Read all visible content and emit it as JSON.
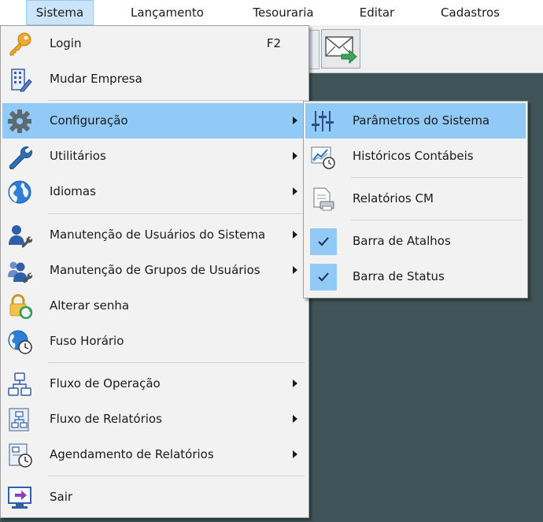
{
  "menubar": {
    "items": [
      {
        "label": "Sistema"
      },
      {
        "label": "Lançamento"
      },
      {
        "label": "Tesouraria"
      },
      {
        "label": "Editar"
      },
      {
        "label": "Cadastros"
      }
    ]
  },
  "menu_sistema": {
    "items": [
      {
        "label": "Login",
        "shortcut": "F2",
        "icon": "key-icon"
      },
      {
        "label": "Mudar Empresa",
        "icon": "building-edit-icon"
      },
      {
        "label": "Configuração",
        "icon": "gear-icon"
      },
      {
        "label": "Utilitários",
        "icon": "wrench-icon"
      },
      {
        "label": "Idiomas",
        "icon": "globe-icon"
      },
      {
        "label": "Manutenção de Usuários do Sistema",
        "icon": "user-wrench-icon"
      },
      {
        "label": "Manutenção de Grupos de Usuários",
        "icon": "group-wrench-icon"
      },
      {
        "label": "Alterar senha",
        "icon": "lock-refresh-icon"
      },
      {
        "label": "Fuso Horário",
        "icon": "globe-clock-icon"
      },
      {
        "label": "Fluxo de Operação",
        "icon": "flowchart-icon"
      },
      {
        "label": "Fluxo de Relatórios",
        "icon": "report-flow-icon"
      },
      {
        "label": "Agendamento de Relatórios",
        "icon": "report-schedule-icon"
      },
      {
        "label": "Sair",
        "icon": "exit-monitor-icon"
      }
    ]
  },
  "submenu_configuracao": {
    "items": [
      {
        "label": "Parâmetros do Sistema",
        "icon": "sliders-icon"
      },
      {
        "label": "Históricos Contábeis",
        "icon": "chart-clock-icon"
      },
      {
        "label": "Relatórios CM",
        "icon": "document-printer-icon"
      },
      {
        "label": "Barra de Atalhos",
        "checked": true,
        "icon": "checkmark-icon"
      },
      {
        "label": "Barra de Status",
        "checked": true,
        "icon": "checkmark-icon"
      }
    ]
  },
  "colors": {
    "highlight": "#91c9f7",
    "menubar_active": "#cce4f7",
    "workspace": "#3f5458"
  }
}
